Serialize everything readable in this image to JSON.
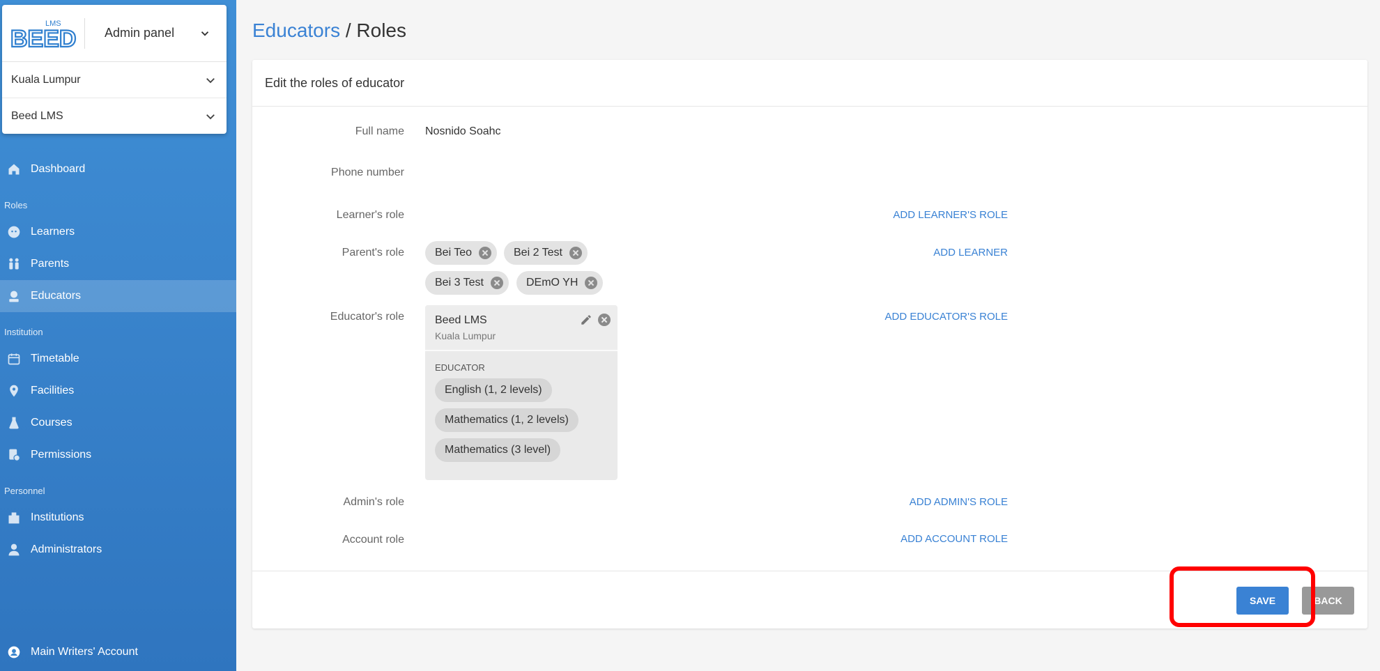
{
  "sidebar": {
    "logo_text": "BEED",
    "logo_sub": "LMS",
    "panel_select": "Admin panel",
    "location_select": "Kuala Lumpur",
    "institution_select": "Beed LMS",
    "dashboard": "Dashboard",
    "section_roles": "Roles",
    "learners": "Learners",
    "parents": "Parents",
    "educators": "Educators",
    "section_institution": "Institution",
    "timetable": "Timetable",
    "facilities": "Facilities",
    "courses": "Courses",
    "permissions": "Permissions",
    "section_personnel": "Personnel",
    "institutions": "Institutions",
    "administrators": "Administrators",
    "account": "Main Writers' Account"
  },
  "breadcrumb": {
    "parent": "Educators",
    "separator": " / ",
    "current": "Roles"
  },
  "card": {
    "title": "Edit the roles of educator",
    "full_name_label": "Full name",
    "full_name_value": "Nosnido Soahc",
    "phone_label": "Phone number",
    "learner_role_label": "Learner's role",
    "add_learner_role": "ADD LEARNER'S ROLE",
    "parent_role_label": "Parent's role",
    "add_learner": "ADD LEARNER",
    "parent_chips": [
      "Bei Teo",
      "Bei 2 Test",
      "Bei 3 Test",
      "DEmO YH"
    ],
    "educator_role_label": "Educator's role",
    "add_educator_role": "ADD EDUCATOR'S ROLE",
    "educator_institution": "Beed LMS",
    "educator_city": "Kuala Lumpur",
    "educator_role_name": "EDUCATOR",
    "subjects": [
      "English (1, 2 levels)",
      "Mathematics (1, 2 levels)",
      "Mathematics (3 level)"
    ],
    "admin_role_label": "Admin's role",
    "add_admin_role": "ADD ADMIN'S ROLE",
    "account_role_label": "Account role",
    "add_account_role": "ADD ACCOUNT ROLE",
    "save_label": "SAVE",
    "back_label": "BACK"
  },
  "colors": {
    "accent": "#3a82d4",
    "sidebar": "#3a85cd",
    "highlight": "#ff0000"
  }
}
